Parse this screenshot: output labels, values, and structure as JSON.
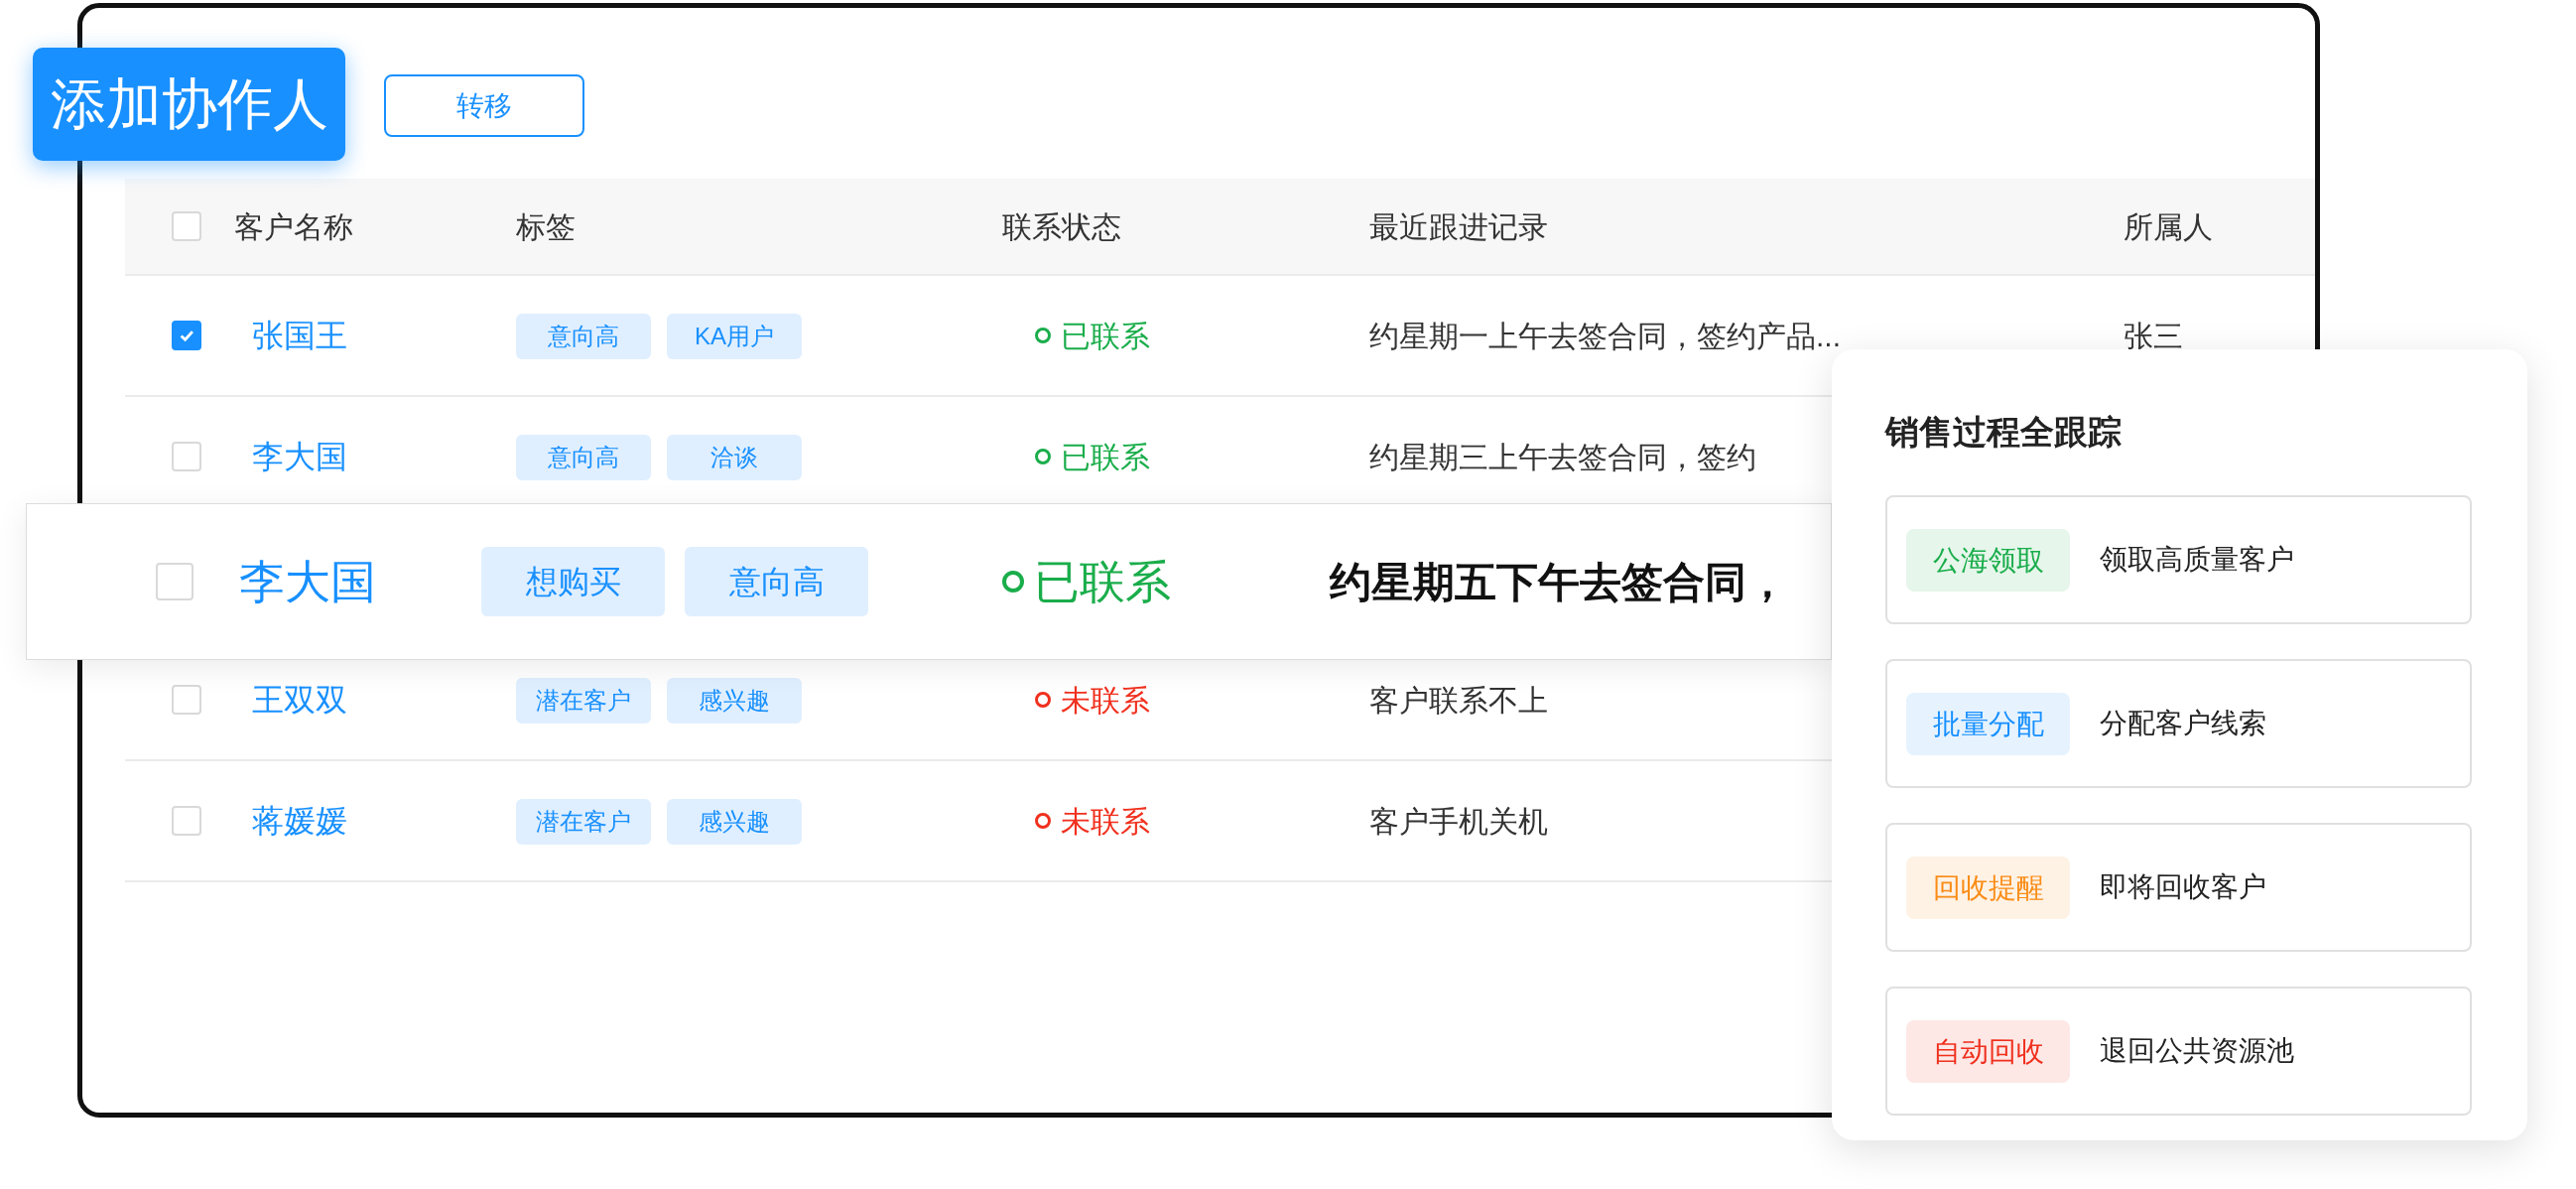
{
  "buttons": [
    {
      "label": "添加协作人",
      "kind": "primary"
    },
    {
      "label": "转移",
      "kind": "outline"
    }
  ],
  "table": {
    "header_checked": false,
    "columns": [
      "客户名称",
      "标签",
      "联系状态",
      "最近跟进记录",
      "所属人"
    ],
    "rows": [
      {
        "kind": "normal",
        "checked": true,
        "name": "张国王",
        "tags": [
          "意向高",
          "KA用户"
        ],
        "contacted": true,
        "status": "已联系",
        "record": "约星期一上午去签合同，签约产品...",
        "owner": "张三"
      },
      {
        "kind": "normal",
        "checked": false,
        "name": "李大国",
        "tags": [
          "意向高",
          "洽谈"
        ],
        "contacted": true,
        "status": "已联系",
        "record": "约星期三上午去签合同，签约"
      },
      {
        "kind": "highlighted",
        "checked": false,
        "name": "李大国",
        "tags": [
          "想购买",
          "意向高"
        ],
        "contacted": true,
        "status": "已联系",
        "record": "约星期五下午去签合同，"
      },
      {
        "kind": "normal",
        "checked": false,
        "name": "王双双",
        "tags": [
          "潜在客户",
          "感兴趣"
        ],
        "contacted": false,
        "status": "未联系",
        "record": "客户联系不上"
      },
      {
        "kind": "normal",
        "checked": false,
        "name": "蒋媛媛",
        "tags": [
          "潜在客户",
          "感兴趣"
        ],
        "contacted": false,
        "status": "未联系",
        "record": "客户手机关机"
      }
    ]
  },
  "panel": {
    "title": "销售过程全跟踪",
    "items": [
      {
        "tag": "公海领取",
        "color": "#1aad4b",
        "text": "领取高质量客户"
      },
      {
        "tag": "批量分配",
        "color": "#1890ff",
        "text": "分配客户线索"
      },
      {
        "tag": "回收提醒",
        "color": "#fa8c16",
        "text": "即将回收客户"
      },
      {
        "tag": "自动回收",
        "color": "#f0301e",
        "text": "退回公共资源池"
      }
    ]
  }
}
